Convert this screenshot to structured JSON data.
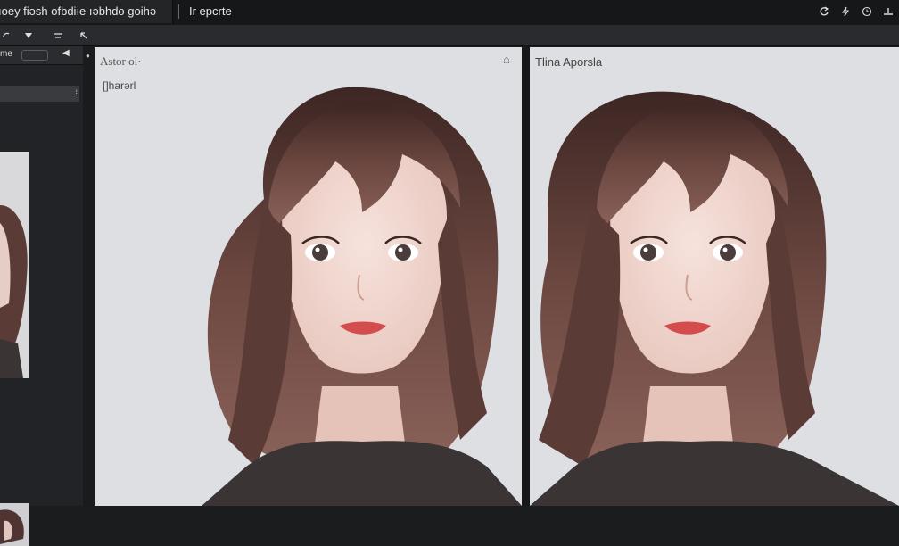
{
  "topbar": {
    "left_tab": "ıoey fiəsh  ofbdiıe  ıəbhdo  goihə",
    "right_tab": "Ir epcrte"
  },
  "panels": {
    "left_viewport_title": "Astor ol·",
    "left_viewport_sublabel": "[]harərl",
    "right_viewport_title": "Tlina Aporsla"
  },
  "colors": {
    "chrome_dark": "#161718",
    "panel": "#222326",
    "viewport_bg": "#dedfe2",
    "hair": "#4a2f2c",
    "skin": "#f1d8d1"
  },
  "icons": [
    "refresh-icon",
    "lightning-icon",
    "clock-icon",
    "minimize-icon",
    "rotate-icon",
    "dropdown-icon",
    "menu-icon",
    "pin-icon",
    "home-icon"
  ]
}
